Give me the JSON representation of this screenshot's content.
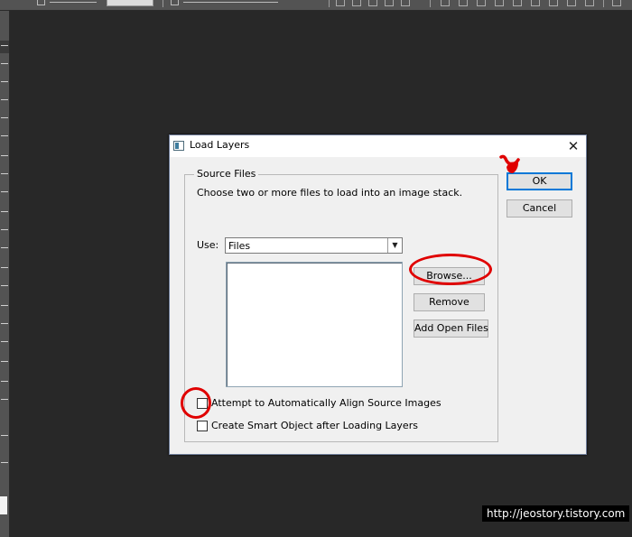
{
  "dialog": {
    "title": "Load Layers",
    "close_glyph": "✕",
    "source_files_legend": "Source Files",
    "description": "Choose two or more files to load into an image stack.",
    "use_label": "Use:",
    "use_value": "Files",
    "dropdown_glyph": "▼",
    "buttons": {
      "ok": "OK",
      "cancel": "Cancel",
      "browse": "Browse...",
      "remove": "Remove",
      "add_open_files": "Add Open Files"
    },
    "checkboxes": {
      "align": {
        "label": "Attempt to Automatically Align Source Images",
        "checked": false
      },
      "smart_object": {
        "label": "Create Smart Object after Loading Layers",
        "checked": false
      }
    }
  },
  "annotations": {
    "color": "#e00000"
  },
  "watermark": "http://jeostory.tistory.com"
}
